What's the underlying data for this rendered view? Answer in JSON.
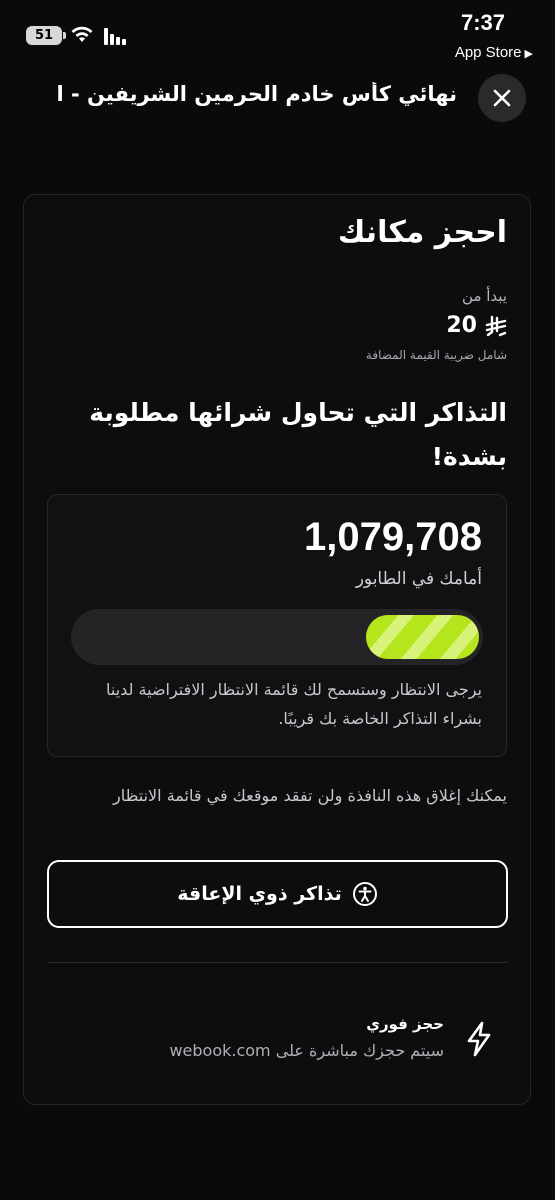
{
  "status_bar": {
    "battery": "51",
    "time": "7:37",
    "back_app": "App Store",
    "back_app_icon": "play-triangle-icon"
  },
  "header": {
    "title": "نهائي كأس خادم الحرمين الشريفين - ال...",
    "close_icon": "close-icon"
  },
  "booking": {
    "title": "احجز مكانك",
    "starts_from": "يبدأ من",
    "price": "20",
    "currency_icon": "riyal-icon",
    "vat_note": "شامل ضريبة القيمة المضافة",
    "demand_title": "التذاكر التي تحاول شرائها مطلوبة بشدة!"
  },
  "queue": {
    "position": "1,079,708",
    "label": "أمامك في الطابور",
    "progress_fraction": 0.28,
    "note": "يرجى الانتظار وستسمح لك قائمة الانتظار الافتراضية لدينا بشراء التذاكر الخاصة بك قريبًا.",
    "accent": "#b5e61d"
  },
  "close_note": "يمكنك إغلاق هذه النافذة ولن تفقد موقعك في قائمة الانتظار",
  "accessibility": {
    "label": "تذاكر ذوي الإعاقة",
    "icon": "accessibility-icon"
  },
  "instant": {
    "title": "حجز فوري",
    "description": "سيتم حجزك مباشرة على webook.com",
    "icon": "lightning-icon"
  }
}
